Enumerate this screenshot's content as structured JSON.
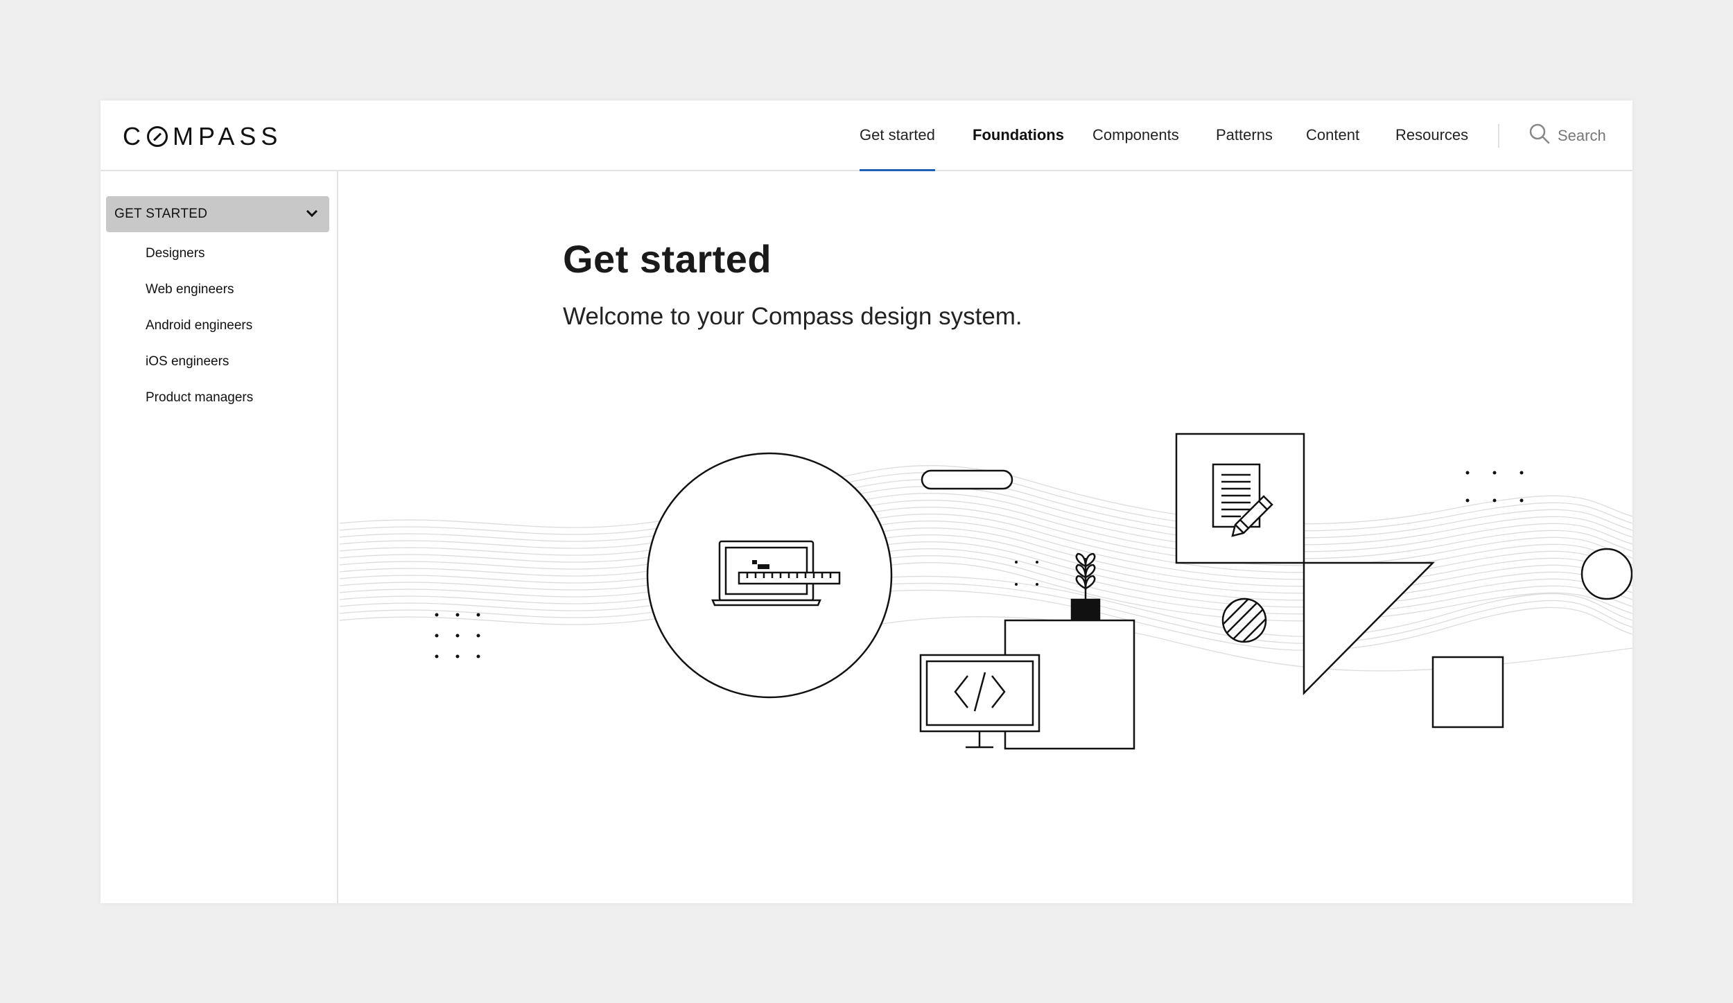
{
  "header": {
    "logo_text": "COMPASS",
    "nav": [
      {
        "label": "Get started",
        "active": true
      },
      {
        "label": "Foundations",
        "bold": true
      },
      {
        "label": "Components"
      },
      {
        "label": "Patterns"
      },
      {
        "label": "Content"
      },
      {
        "label": "Resources"
      }
    ],
    "search_label": "Search"
  },
  "sidebar": {
    "section_label": "GET STARTED",
    "items": [
      {
        "label": "Designers"
      },
      {
        "label": "Web engineers"
      },
      {
        "label": "Android engineers"
      },
      {
        "label": "iOS engineers"
      },
      {
        "label": "Product managers"
      }
    ]
  },
  "main": {
    "title": "Get started",
    "subtitle": "Welcome to your Compass design system."
  },
  "colors": {
    "accent": "#1f5fb6",
    "sidebar_header_bg": "#c8c8c8",
    "page_bg": "#efefef"
  },
  "icons": [
    "compass-logo",
    "search-icon",
    "chevron-down-icon",
    "laptop-ruler-icon",
    "document-pencil-icon",
    "code-monitor-icon",
    "plant-icon"
  ]
}
